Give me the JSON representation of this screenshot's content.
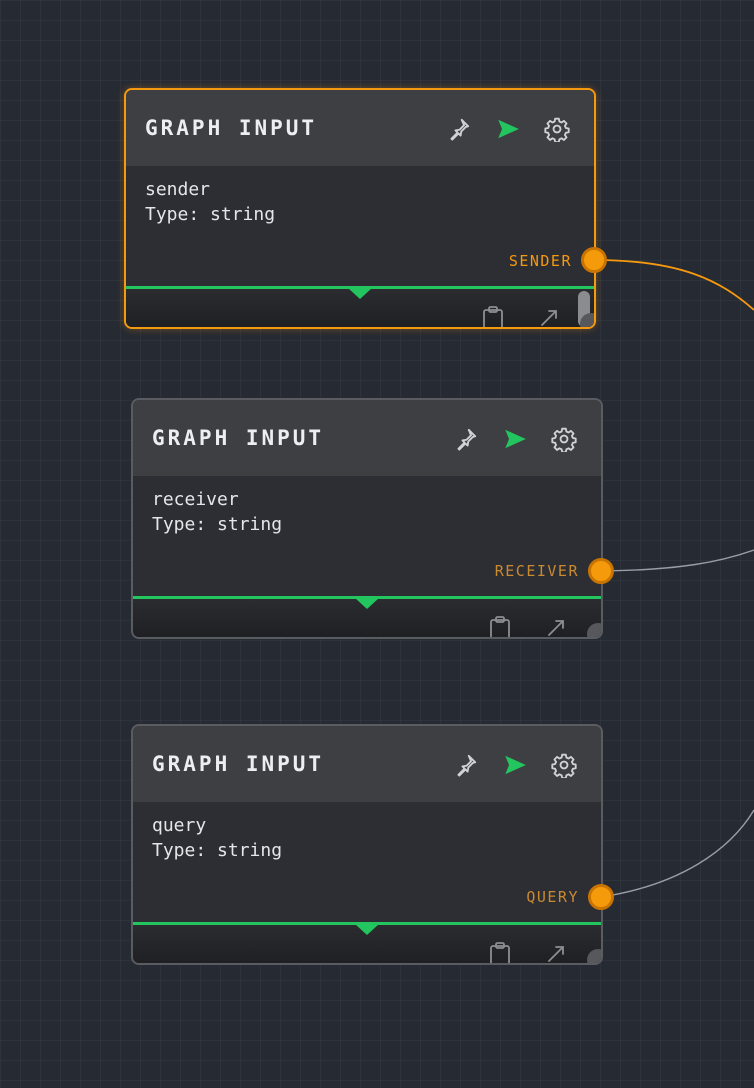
{
  "nodes": [
    {
      "title": "GRAPH INPUT",
      "name": "sender",
      "type_text": "Type: string",
      "output_port": "SENDER",
      "selected": true
    },
    {
      "title": "GRAPH INPUT",
      "name": "receiver",
      "type_text": "Type: string",
      "output_port": "RECEIVER",
      "selected": false
    },
    {
      "title": "GRAPH INPUT",
      "name": "query",
      "type_text": "Type: string",
      "output_port": "QUERY",
      "selected": false
    }
  ],
  "icons": {
    "pin": "pin-icon",
    "run": "send-icon",
    "settings": "gear-icon",
    "clipboard": "clipboard-icon",
    "expand": "expand-icon",
    "collapse": "triangle-down-icon"
  },
  "colors": {
    "canvas": "#262a33",
    "node_bg": "#2c2e33",
    "node_header": "#3e3f42",
    "selected_border": "#f5990f",
    "port": "#f59a0a",
    "run_green": "#22c55e",
    "wire_selected": "#f5990f",
    "wire_default": "#9a9da3"
  }
}
